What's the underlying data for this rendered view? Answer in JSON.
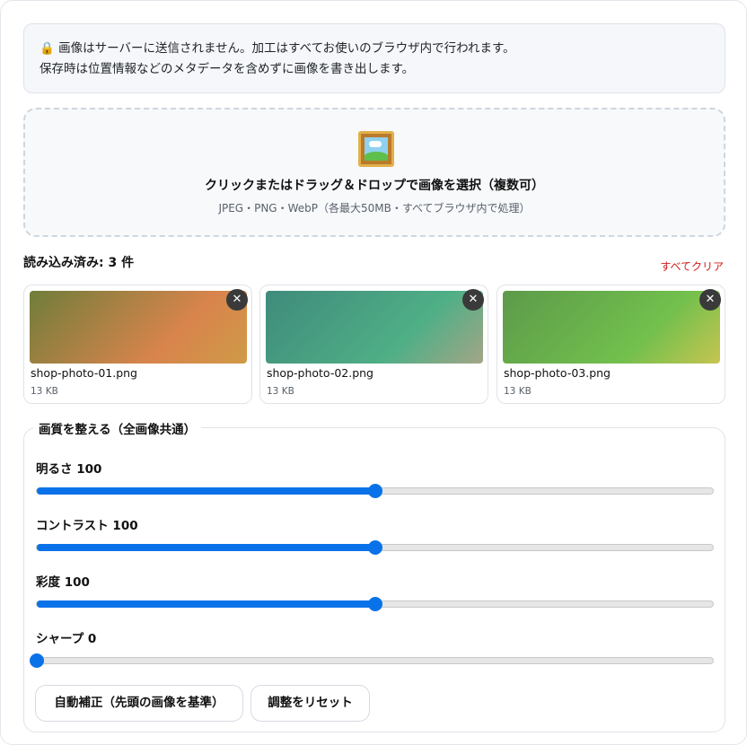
{
  "notice": {
    "icon": "lock-icon",
    "line1": "🔒 画像はサーバーに送信されません。加工はすべてお使いのブラウザ内で行われます。",
    "line2": "保存時は位置情報などのメタデータを含めずに画像を書き出します。"
  },
  "dropzone": {
    "icon": "picture-frame-icon",
    "title": "クリックまたはドラッグ＆ドロップで画像を選択（複数可）",
    "subtitle": "JPEG・PNG・WebP（各最大50MB・すべてブラウザ内で処理）"
  },
  "loaded": {
    "title": "読み込み済み: 3 件",
    "clear_label": "すべてクリア"
  },
  "thumbnails": [
    {
      "name": "shop-photo-01.png",
      "size": "13 KB",
      "gradient": [
        "#6f7d3a",
        "#d8844c",
        "#cf9a47"
      ]
    },
    {
      "name": "shop-photo-02.png",
      "size": "13 KB",
      "gradient": [
        "#3f8b7b",
        "#4faf86",
        "#a4a586"
      ]
    },
    {
      "name": "shop-photo-03.png",
      "size": "13 KB",
      "gradient": [
        "#5c9a4a",
        "#72c04d",
        "#c7c451"
      ]
    }
  ],
  "adjust": {
    "legend": "画質を整える（全画像共通）",
    "controls": [
      {
        "label": "明るさ 100",
        "value": 100,
        "min": 0,
        "max": 200
      },
      {
        "label": "コントラスト 100",
        "value": 100,
        "min": 0,
        "max": 200
      },
      {
        "label": "彩度 100",
        "value": 100,
        "min": 0,
        "max": 200
      },
      {
        "label": "シャープ 0",
        "value": 0,
        "min": 0,
        "max": 100
      }
    ],
    "auto_button": "自動補正（先頭の画像を基準）",
    "reset_button": "調整をリセット"
  },
  "colors": {
    "accent": "#0a72e8",
    "danger": "#d01a1a"
  }
}
